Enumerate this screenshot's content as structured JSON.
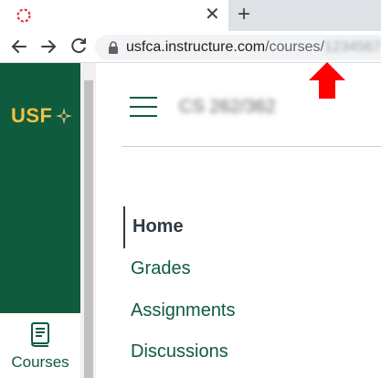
{
  "browser": {
    "tab": {
      "close_glyph": "✕",
      "favicon": "canvas-favicon-icon"
    },
    "new_tab_glyph": "+",
    "nav": {
      "back": "←",
      "forward": "→",
      "reload": "↻"
    },
    "address_bar": {
      "domain": "usfca.instructure.com",
      "path": "/courses/",
      "course_id_blurred": "1234567"
    }
  },
  "annotation": {
    "arrow_color": "#ff0000"
  },
  "global_nav": {
    "logo_text": "USF",
    "courses_label": "Courses",
    "brand_color": "#0f5b3e",
    "logo_color": "#f2c144"
  },
  "course": {
    "title_blurred": "CS 262/362"
  },
  "course_nav": {
    "items": [
      {
        "label": "Home",
        "active": true
      },
      {
        "label": "Grades",
        "active": false
      },
      {
        "label": "Assignments",
        "active": false
      },
      {
        "label": "Discussions",
        "active": false
      }
    ]
  }
}
